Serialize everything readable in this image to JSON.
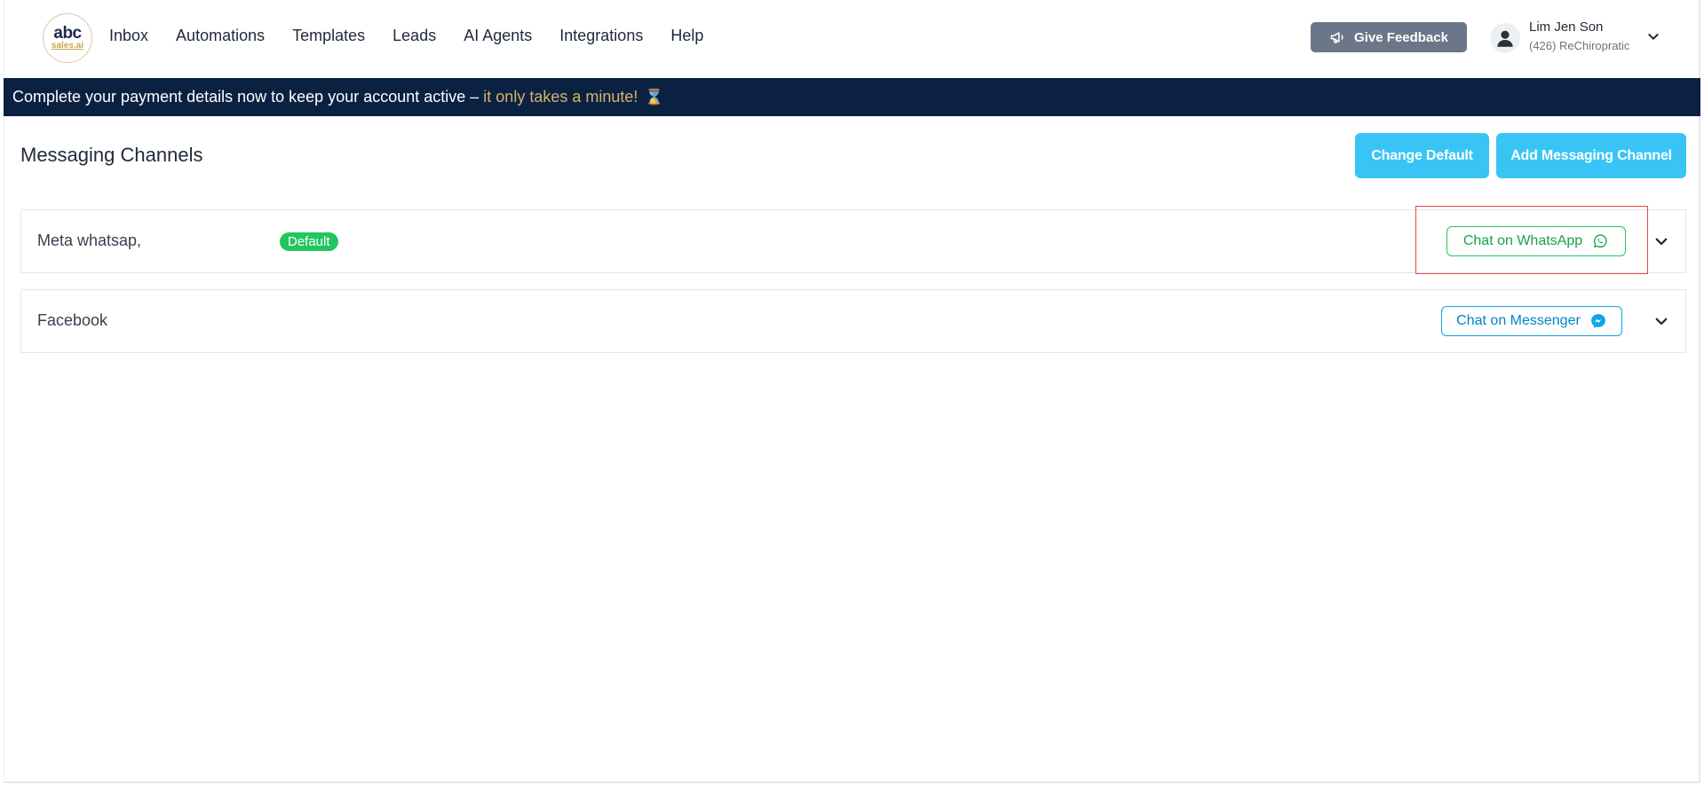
{
  "header": {
    "logo": {
      "main": "abc",
      "sub": "sales.ai"
    },
    "nav": [
      "Inbox",
      "Automations",
      "Templates",
      "Leads",
      "AI Agents",
      "Integrations",
      "Help"
    ],
    "feedback_label": "Give Feedback",
    "user": {
      "name": "Lim Jen Son",
      "company": "(426) ReChiropratic"
    }
  },
  "banner": {
    "text": "Complete your payment details now to keep your account active –",
    "highlight": "it only takes a minute!",
    "icon": "⌛"
  },
  "page": {
    "title": "Messaging Channels",
    "change_default_label": "Change Default",
    "add_channel_label": "Add Messaging Channel"
  },
  "channels": [
    {
      "name": "Meta whatsap,",
      "badge": "Default",
      "action_label": "Chat on WhatsApp",
      "icon": "whatsapp-icon"
    },
    {
      "name": "Facebook",
      "badge": "",
      "action_label": "Chat on Messenger",
      "icon": "messenger-icon"
    }
  ],
  "colors": {
    "banner_bg": "#0b2142",
    "primary": "#38c5f5",
    "whatsapp": "#22c55e",
    "messenger": "#0ea5e9",
    "highlight_box": "#e24a4a"
  }
}
